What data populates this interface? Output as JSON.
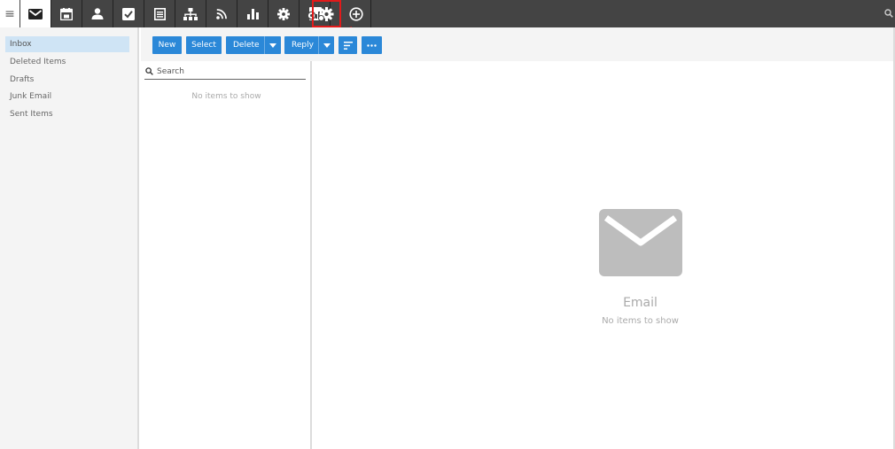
{
  "topnav": {
    "menu_icon": "hamburger-icon",
    "items": [
      {
        "icon": "mail-icon",
        "active": true
      },
      {
        "icon": "calendar-icon"
      },
      {
        "icon": "people-icon"
      },
      {
        "icon": "tasks-icon"
      },
      {
        "icon": "notes-icon"
      },
      {
        "icon": "org-chart-icon"
      },
      {
        "icon": "rss-icon"
      },
      {
        "icon": "bar-chart-icon"
      },
      {
        "icon": "gear-icon"
      },
      {
        "icon": "report-app-icon"
      },
      {
        "icon": "gear-settings-icon",
        "highlighted": true
      },
      {
        "icon": "add-circle-icon"
      }
    ],
    "search_icon": "search-icon"
  },
  "sidebar": {
    "folders": [
      {
        "label": "Inbox",
        "selected": true
      },
      {
        "label": "Deleted Items"
      },
      {
        "label": "Drafts"
      },
      {
        "label": "Junk Email"
      },
      {
        "label": "Sent Items"
      }
    ]
  },
  "toolbar": {
    "new_label": "New",
    "select_label": "Select",
    "delete_label": "Delete",
    "reply_label": "Reply"
  },
  "message_list": {
    "search_placeholder": "Search",
    "empty_text": "No items to show"
  },
  "reading_pane": {
    "title": "Email",
    "subtitle": "No items to show"
  },
  "colors": {
    "accent": "#2b88d8",
    "nav_background": "#444444",
    "selected_folder": "#cfe4f5",
    "annotation": "#e21a1a"
  }
}
